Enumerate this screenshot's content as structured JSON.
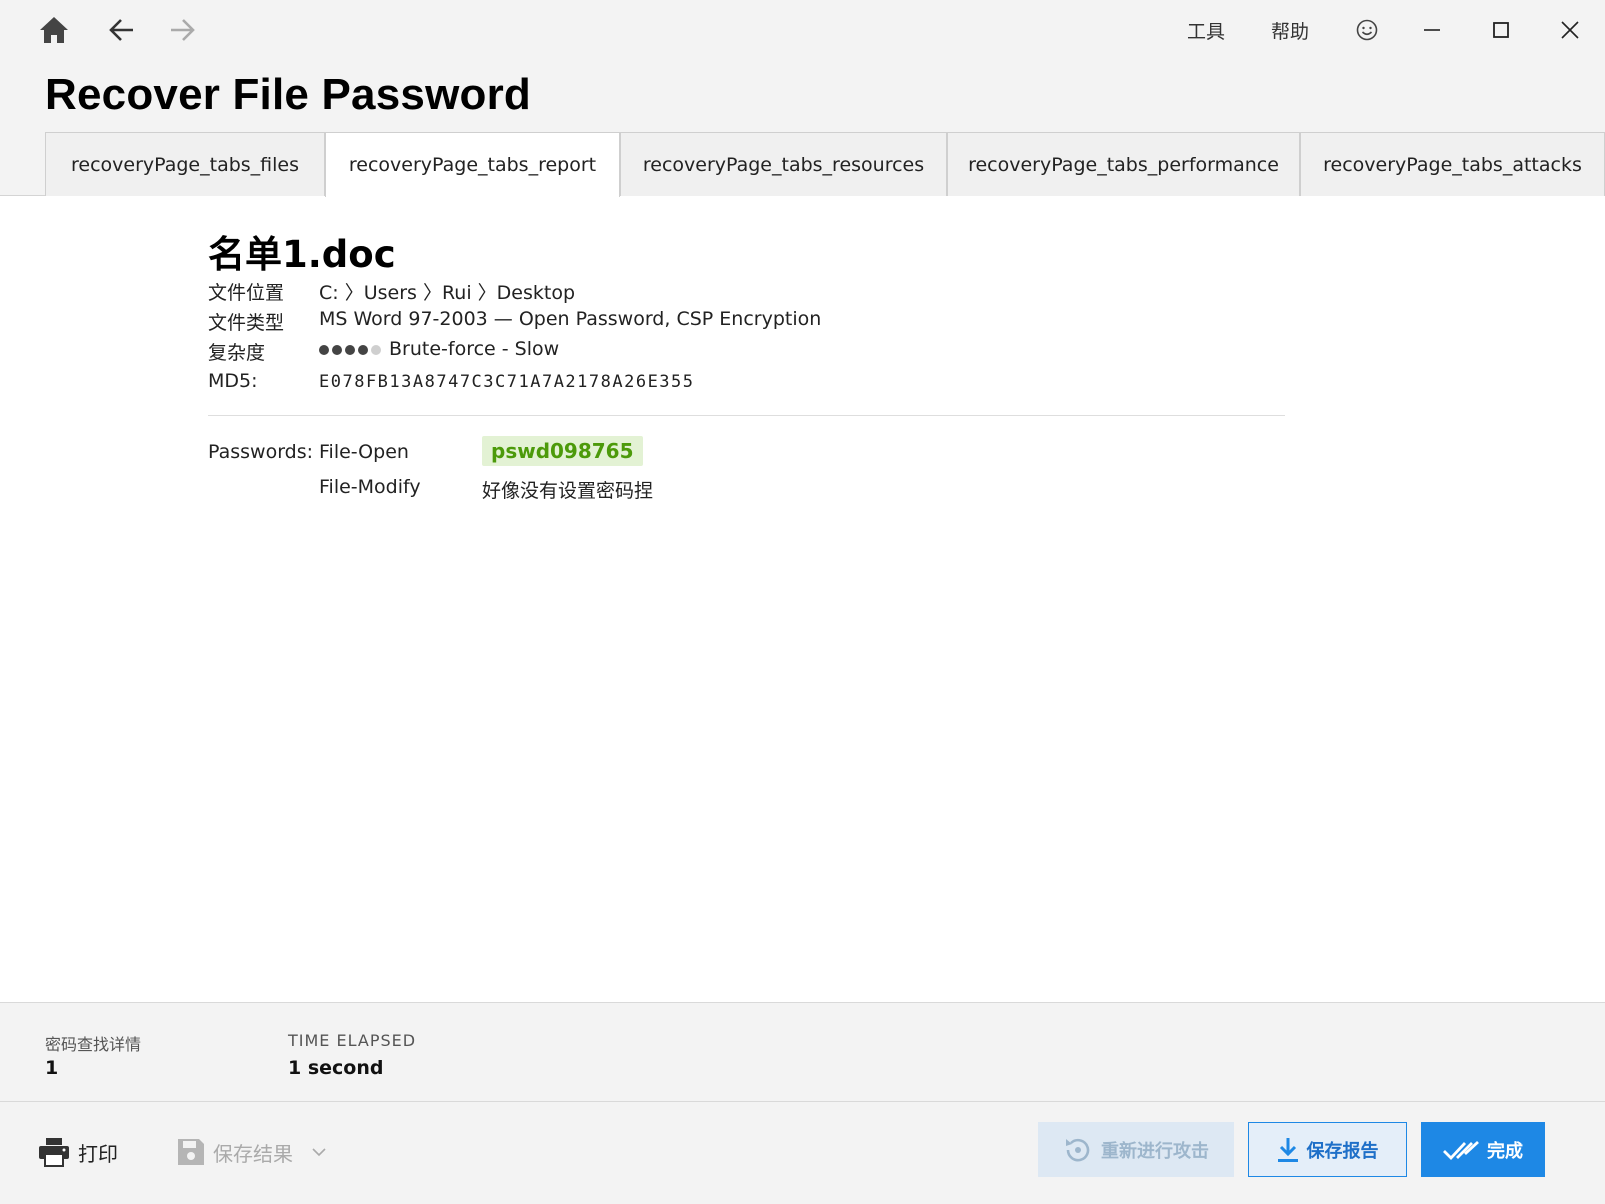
{
  "titlebar": {
    "menu_tools": "工具",
    "menu_help": "帮助"
  },
  "page_title": "Recover File Password",
  "tabs": [
    {
      "label": "recoveryPage_tabs_files",
      "active": false
    },
    {
      "label": "recoveryPage_tabs_report",
      "active": true
    },
    {
      "label": "recoveryPage_tabs_resources",
      "active": false
    },
    {
      "label": "recoveryPage_tabs_performance",
      "active": false
    },
    {
      "label": "recoveryPage_tabs_attacks",
      "active": false
    }
  ],
  "report": {
    "file_name": "名单1.doc",
    "location_label": "文件位置",
    "location_value": "C: 〉Users 〉Rui 〉Desktop",
    "type_label": "文件类型",
    "type_value": "MS Word 97-2003 — Open Password, CSP Encryption",
    "complexity_label": "复杂度",
    "complexity_level": 4,
    "complexity_max": 5,
    "complexity_value": "Brute-force - Slow",
    "md5_label": "MD5:",
    "md5_value": "E078FB13A8747C3C71A7A2178A26E355",
    "passwords_label": "Passwords:",
    "file_open_label": "File-Open",
    "file_open_value": "pswd098765",
    "file_modify_label": "File-Modify",
    "file_modify_value": "好像没有设置密码捏"
  },
  "stats": {
    "search_details_label": "密码查找详情",
    "search_details_value": "1",
    "time_elapsed_label": "TIME ELAPSED",
    "time_elapsed_value": "1 second"
  },
  "bottom": {
    "print_label": "打印",
    "save_result_label": "保存结果",
    "retry_label": "重新进行攻击",
    "save_report_label": "保存报告",
    "done_label": "完成"
  },
  "colors": {
    "accent": "#1e88e5",
    "password_green": "#4c9a0a",
    "password_bg": "#e3f2d4"
  }
}
